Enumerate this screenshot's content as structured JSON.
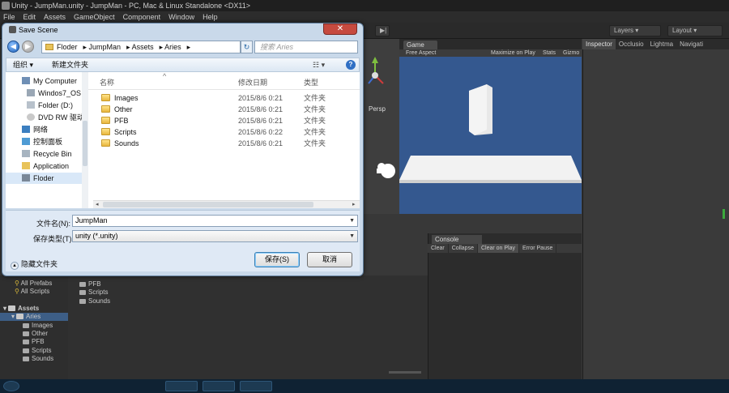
{
  "window": {
    "title": "Unity - JumpMan.unity - JumpMan - PC, Mac & Linux Standalone <DX11>"
  },
  "menu": [
    "File",
    "Edit",
    "Assets",
    "GameObject",
    "Component",
    "Window",
    "Help"
  ],
  "toolbar": {
    "layers_label": "Layers",
    "layout_label": "Layout"
  },
  "game": {
    "tab_label": "Game",
    "aspect_label": "Free Aspect",
    "maximize_label": "Maximize on Play",
    "stats_label": "Stats",
    "gizmos_label": "Gizmo",
    "bg_color": "#34588f"
  },
  "scene": {
    "persp_label": "Persp"
  },
  "inspector": {
    "tabs": [
      "Inspector",
      "Occlusio",
      "Lightma",
      "Navigati"
    ]
  },
  "console": {
    "tab_label": "Console",
    "buttons": [
      "Clear",
      "Collapse",
      "Clear on Play",
      "Error Pause"
    ]
  },
  "project": {
    "favorites": [
      "All Prefabs",
      "All Scripts"
    ],
    "assets_label": "Assets",
    "aries_label": "Aries",
    "aries_children": [
      "Images",
      "Other",
      "PFB",
      "Scripts",
      "Sounds"
    ],
    "right_items": [
      "PFB",
      "Scripts",
      "Sounds"
    ]
  },
  "dialog": {
    "title": "Save Scene",
    "close_glyph": "✕",
    "breadcrumb": [
      "Floder",
      "JumpMan",
      "Assets",
      "Aries"
    ],
    "search_placeholder": "搜索 Aries",
    "organize_label": "组织 ▾",
    "new_folder_label": "新建文件夹",
    "nav_items": [
      "My Computer",
      "Windos7_OS (",
      "Folder (D:)",
      "DVD RW 驱动",
      "网络",
      "控制面板",
      "Recycle Bin",
      "Application",
      "Floder"
    ],
    "columns": {
      "name": "名称",
      "date": "修改日期",
      "type": "类型"
    },
    "files": [
      {
        "name": "Images",
        "date": "2015/8/6 0:21",
        "type": "文件夹"
      },
      {
        "name": "Other",
        "date": "2015/8/6 0:21",
        "type": "文件夹"
      },
      {
        "name": "PFB",
        "date": "2015/8/6 0:21",
        "type": "文件夹"
      },
      {
        "name": "Scripts",
        "date": "2015/8/6 0:22",
        "type": "文件夹"
      },
      {
        "name": "Sounds",
        "date": "2015/8/6 0:21",
        "type": "文件夹"
      }
    ],
    "filename_label": "文件名(N):",
    "filename_value": "JumpMan",
    "filetype_label": "保存类型(T):",
    "filetype_value": "unity (*.unity)",
    "hide_folders_label": "隐藏文件夹",
    "save_label": "保存(S)",
    "cancel_label": "取消"
  }
}
